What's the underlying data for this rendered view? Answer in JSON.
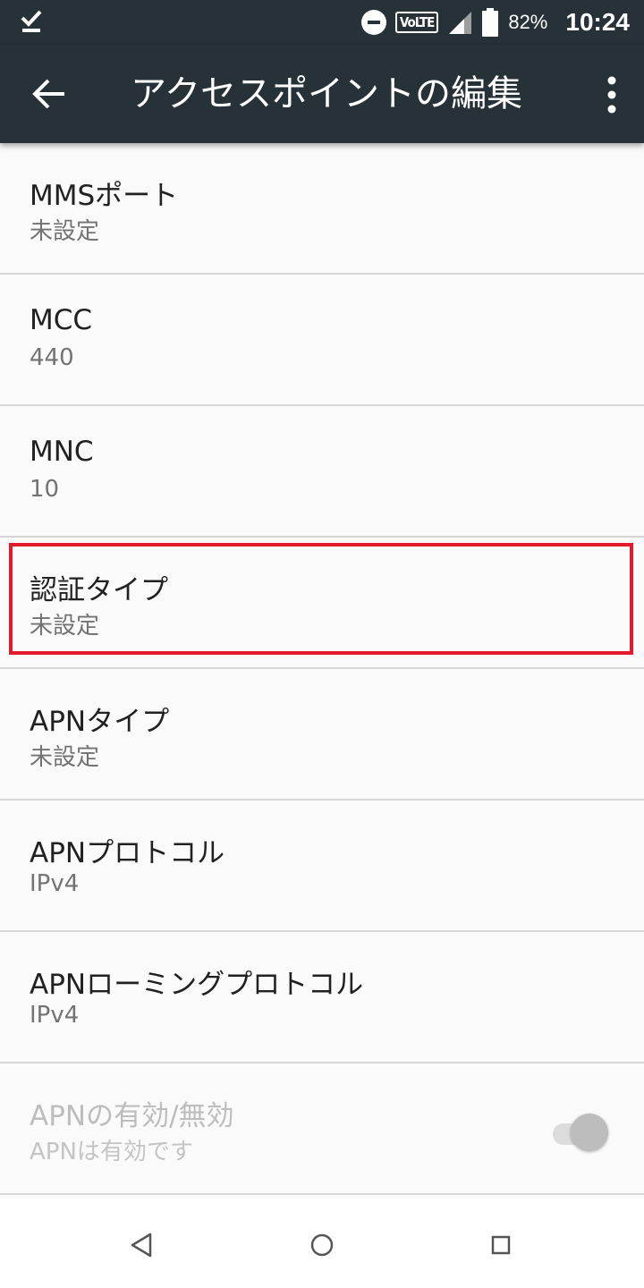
{
  "status_bar": {
    "battery_percent": "82%",
    "network_badge": "VoLTE",
    "time": "10:24",
    "icons": [
      "check-icon",
      "do-not-disturb-icon",
      "volte-icon",
      "signal-icon",
      "battery-icon"
    ]
  },
  "app_bar": {
    "title": "アクセスポイントの編集",
    "back_icon": "arrow-left-icon",
    "menu_icon": "more-vertical-icon",
    "background_color": "#263238"
  },
  "settings": [
    {
      "title": "MMSポート",
      "value": "未設定"
    },
    {
      "title": "MCC",
      "value": "440"
    },
    {
      "title": "MNC",
      "value": "10"
    },
    {
      "title": "認証タイプ",
      "value": "未設定",
      "highlighted": true
    },
    {
      "title": "APNタイプ",
      "value": "未設定"
    },
    {
      "title": "APNプロトコル",
      "value": "IPv4"
    },
    {
      "title": "APNローミングプロトコル",
      "value": "IPv4"
    },
    {
      "title": "APNの有効/無効",
      "value": "APNは有効です",
      "enabled": false,
      "toggle_on": true
    }
  ],
  "highlight_color": "#e21a2c",
  "nav_bar": {
    "icons": [
      "back-triangle-icon",
      "home-circle-icon",
      "recents-square-icon"
    ]
  }
}
